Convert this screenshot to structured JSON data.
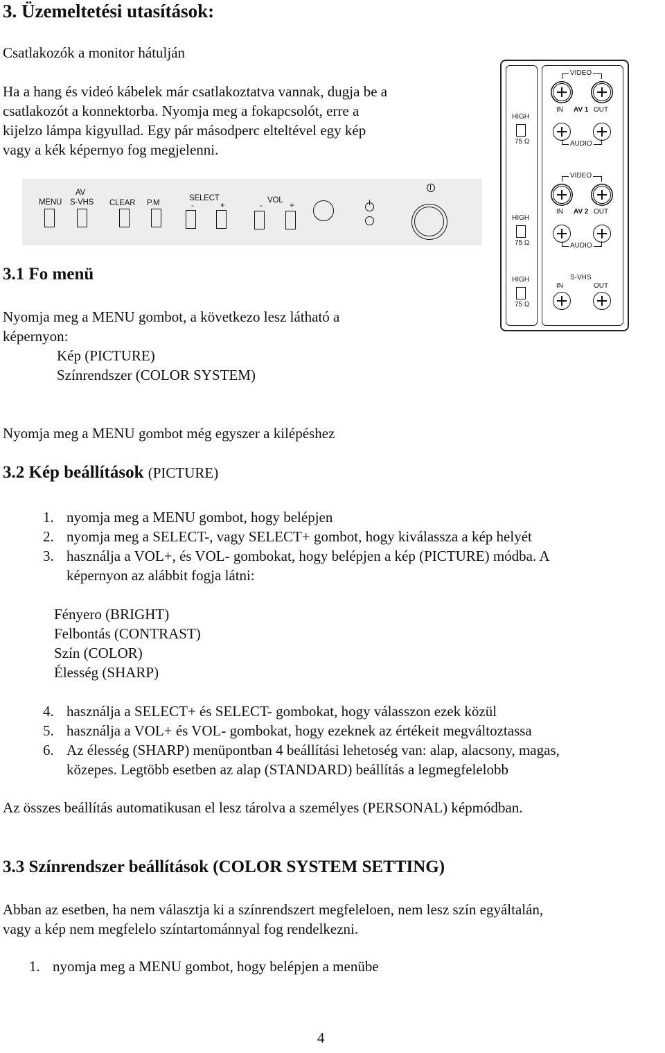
{
  "heading": "3. Üzemeltetési utasítások:",
  "connectors_label": "Csatlakozók a monitor hátulján",
  "intro_lines": [
    "Ha a hang és videó kábelek már csatlakoztatva vannak, dugja be a",
    "csatlakozót a konnektorba. Nyomja meg a fokapcsolót, erre a",
    "kijelzo lámpa kigyullad. Egy pár másodperc elteltével egy kép",
    "vagy a kék képernyo fog megjelenni."
  ],
  "front_panel": {
    "labels": {
      "menu": "MENU",
      "av": "AV",
      "svhs": "S-VHS",
      "clear": "CLEAR",
      "pm": "P.M",
      "select": "SELECT",
      "select_minus": "-",
      "select_plus": "+",
      "vol": "VOL",
      "vol_minus": "-",
      "vol_plus": "+"
    },
    "icons": [
      "remote-sensor",
      "standby-indicator",
      "power-led",
      "power-button"
    ]
  },
  "rear_panel": {
    "av1": {
      "video": "VIDEO",
      "in": "IN",
      "name": "AV 1",
      "out": "OUT",
      "audio": "AUDIO",
      "switch_top": "HIGH",
      "switch_bottom": "75 Ω"
    },
    "av2": {
      "video": "VIDEO",
      "in": "IN",
      "name": "AV 2",
      "out": "OUT",
      "audio": "AUDIO",
      "switch_top": "HIGH",
      "switch_bottom": "75 Ω"
    },
    "svhs": {
      "name": "S-VHS",
      "in": "IN",
      "out": "OUT",
      "switch_top": "HIGH",
      "switch_bottom": "75 Ω"
    }
  },
  "section_3_1": {
    "title": "3.1 Fo menü",
    "lines": [
      "Nyomja meg a MENU gombot, a következo lesz látható a",
      "képernyon:"
    ],
    "menu_items": [
      "Kép (PICTURE)",
      "Színrendszer (COLOR SYSTEM)"
    ],
    "exit_note": "Nyomja meg a MENU gombot még egyszer a kilépéshez"
  },
  "section_3_2": {
    "title_bold": "3.2 Kép beállítások",
    "title_plain": "(PICTURE)",
    "steps_a": [
      {
        "num": "1.",
        "lines": [
          "nyomja meg a MENU gombot, hogy belépjen"
        ]
      },
      {
        "num": "2.",
        "lines": [
          "nyomja meg a SELECT-, vagy SELECT+ gombot, hogy kiválassza a kép helyét"
        ]
      },
      {
        "num": "3.",
        "lines": [
          "használja a VOL+, és VOL- gombokat, hogy belépjen a kép (PICTURE) módba. A",
          "képernyon az alábbit fogja látni:"
        ]
      }
    ],
    "picture_items": [
      "Fényero (BRIGHT)",
      "Felbontás (CONTRAST)",
      "Szín (COLOR)",
      "Élesség (SHARP)"
    ],
    "steps_b": [
      {
        "num": "4.",
        "lines": [
          "használja a SELECT+ és SELECT- gombokat, hogy válasszon ezek közül"
        ]
      },
      {
        "num": "5.",
        "lines": [
          "használja a VOL+ és VOL- gombokat, hogy ezeknek az értékeit megváltoztassa"
        ]
      },
      {
        "num": "6.",
        "lines": [
          "Az élesség (SHARP) menüpontban 4 beállítási lehetoség van: alap, alacsony, magas,",
          "közepes. Legtöbb esetben az alap (STANDARD) beállítás a legmegfelelobb"
        ]
      }
    ],
    "note": "Az összes beállítás automatikusan el lesz tárolva a személyes (PERSONAL) képmódban."
  },
  "section_3_3": {
    "title": "3.3 Színrendszer beállítások (COLOR SYSTEM SETTING)",
    "lines": [
      "Abban az esetben, ha nem választja ki a színrendszert megfeleloen, nem lesz szín egyáltalán,",
      "vagy a kép nem megfelelo színtartománnyal fog rendelkezni."
    ],
    "steps": [
      {
        "num": "1.",
        "lines": [
          "nyomja meg a MENU gombot, hogy belépjen a menübe"
        ]
      }
    ]
  },
  "page_number": "4"
}
